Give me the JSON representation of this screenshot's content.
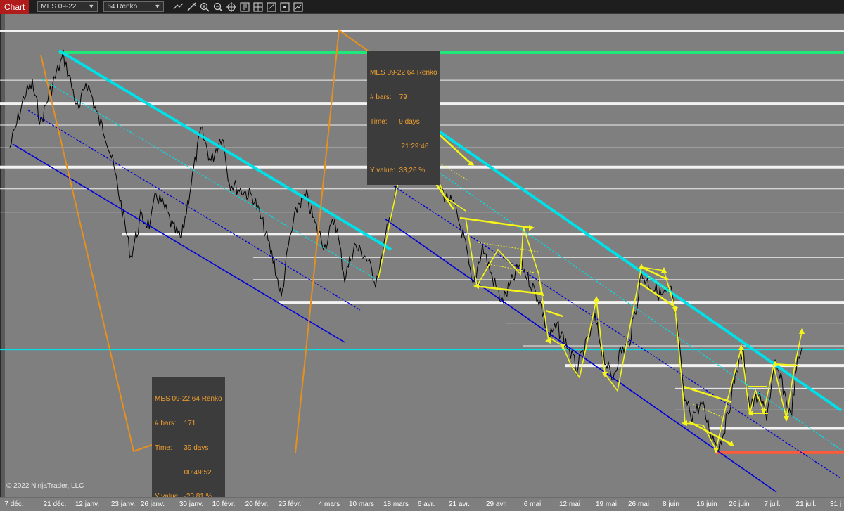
{
  "toolbar": {
    "tab_label": "Chart",
    "instrument": "MES 09-22",
    "period": "64 Renko",
    "tools": [
      "line-tool-icon",
      "draw-tool-icon",
      "zoom-in-icon",
      "zoom-out-icon",
      "crosshair-icon",
      "properties-icon",
      "data-box-icon",
      "data-series-icon",
      "strategy-icon",
      "indicator-icon"
    ]
  },
  "copyright": "© 2022 NinjaTrader, LLC",
  "info_boxes": [
    {
      "lines": [
        "MES 09-22 64 Renko",
        "# bars:    79",
        "Time:      9 days",
        "                21:29:46",
        "Y value:  33,26 %"
      ]
    },
    {
      "lines": [
        "MES 09-22 64 Renko",
        "# bars:    171",
        "Time:      39 days",
        "               00:49:52",
        "Y value:  -23,81 %"
      ]
    }
  ],
  "colors": {
    "background": "#7f7f7f",
    "price": "#000000",
    "channel_primary": "#00e0e8",
    "channel_secondary": "#0000d8",
    "elliott": "#f5f51a",
    "measure": "#e8901c",
    "resistance_top": "#1ee87a",
    "support_bottom": "#ff5a3a",
    "level": "#f2f2f2"
  },
  "chart_data": {
    "type": "line",
    "x_ticks": [
      "7 déc.",
      "21 déc.",
      "12 janv.",
      "23 janv.",
      "26 janv.",
      "30 janv.",
      "10 févr.",
      "20 févr.",
      "25 févr.",
      "4 mars",
      "10 mars",
      "18 mars",
      "6 avr.",
      "21 avr.",
      "29 avr.",
      "6 mai",
      "12 mai",
      "19 mai",
      "26 mai",
      "8 juin",
      "16 juin",
      "26 juin",
      "7 juil.",
      "21 juil.",
      "31 j"
    ],
    "horizontal_levels": [
      {
        "kind": "thick",
        "color": "level",
        "y_frac": 0.035,
        "x_from": 0.0,
        "x_to": 1.0
      },
      {
        "kind": "thick",
        "color": "resistance_top",
        "y_frac": 0.08,
        "x_from": 0.07,
        "x_to": 1.0
      },
      {
        "kind": "thin",
        "color": "level",
        "y_frac": 0.137,
        "x_from": 0.0,
        "x_to": 1.0
      },
      {
        "kind": "thick",
        "color": "level",
        "y_frac": 0.185,
        "x_from": 0.0,
        "x_to": 1.0
      },
      {
        "kind": "thin",
        "color": "level",
        "y_frac": 0.23,
        "x_from": 0.0,
        "x_to": 1.0
      },
      {
        "kind": "thin",
        "color": "level",
        "y_frac": 0.277,
        "x_from": 0.0,
        "x_to": 1.0
      },
      {
        "kind": "thick",
        "color": "level",
        "y_frac": 0.317,
        "x_from": 0.0,
        "x_to": 1.0
      },
      {
        "kind": "thin",
        "color": "level",
        "y_frac": 0.362,
        "x_from": 0.0,
        "x_to": 1.0
      },
      {
        "kind": "thin",
        "color": "level",
        "y_frac": 0.41,
        "x_from": 0.0,
        "x_to": 1.0
      },
      {
        "kind": "thick",
        "color": "level",
        "y_frac": 0.456,
        "x_from": 0.145,
        "x_to": 1.0
      },
      {
        "kind": "thin",
        "color": "level",
        "y_frac": 0.504,
        "x_from": 0.3,
        "x_to": 1.0
      },
      {
        "kind": "thin",
        "color": "level",
        "y_frac": 0.55,
        "x_from": 0.3,
        "x_to": 1.0
      },
      {
        "kind": "thick",
        "color": "level",
        "y_frac": 0.597,
        "x_from": 0.33,
        "x_to": 1.0
      },
      {
        "kind": "thin",
        "color": "level",
        "y_frac": 0.64,
        "x_from": 0.6,
        "x_to": 1.0
      },
      {
        "kind": "thin",
        "color": "level",
        "y_frac": 0.687,
        "x_from": 0.62,
        "x_to": 1.0
      },
      {
        "kind": "cyan-thin",
        "color": "channel_primary",
        "y_frac": 0.695,
        "x_from": 0.0,
        "x_to": 1.0
      },
      {
        "kind": "thick",
        "color": "level",
        "y_frac": 0.728,
        "x_from": 0.67,
        "x_to": 1.0
      },
      {
        "kind": "thin",
        "color": "level",
        "y_frac": 0.775,
        "x_from": 0.8,
        "x_to": 1.0
      },
      {
        "kind": "thin",
        "color": "level",
        "y_frac": 0.82,
        "x_from": 0.8,
        "x_to": 1.0
      },
      {
        "kind": "thick",
        "color": "level",
        "y_frac": 0.858,
        "x_from": 0.84,
        "x_to": 1.0
      },
      {
        "kind": "thick",
        "color": "support_bottom",
        "y_frac": 0.908,
        "x_from": 0.848,
        "x_to": 1.0
      }
    ]
  }
}
